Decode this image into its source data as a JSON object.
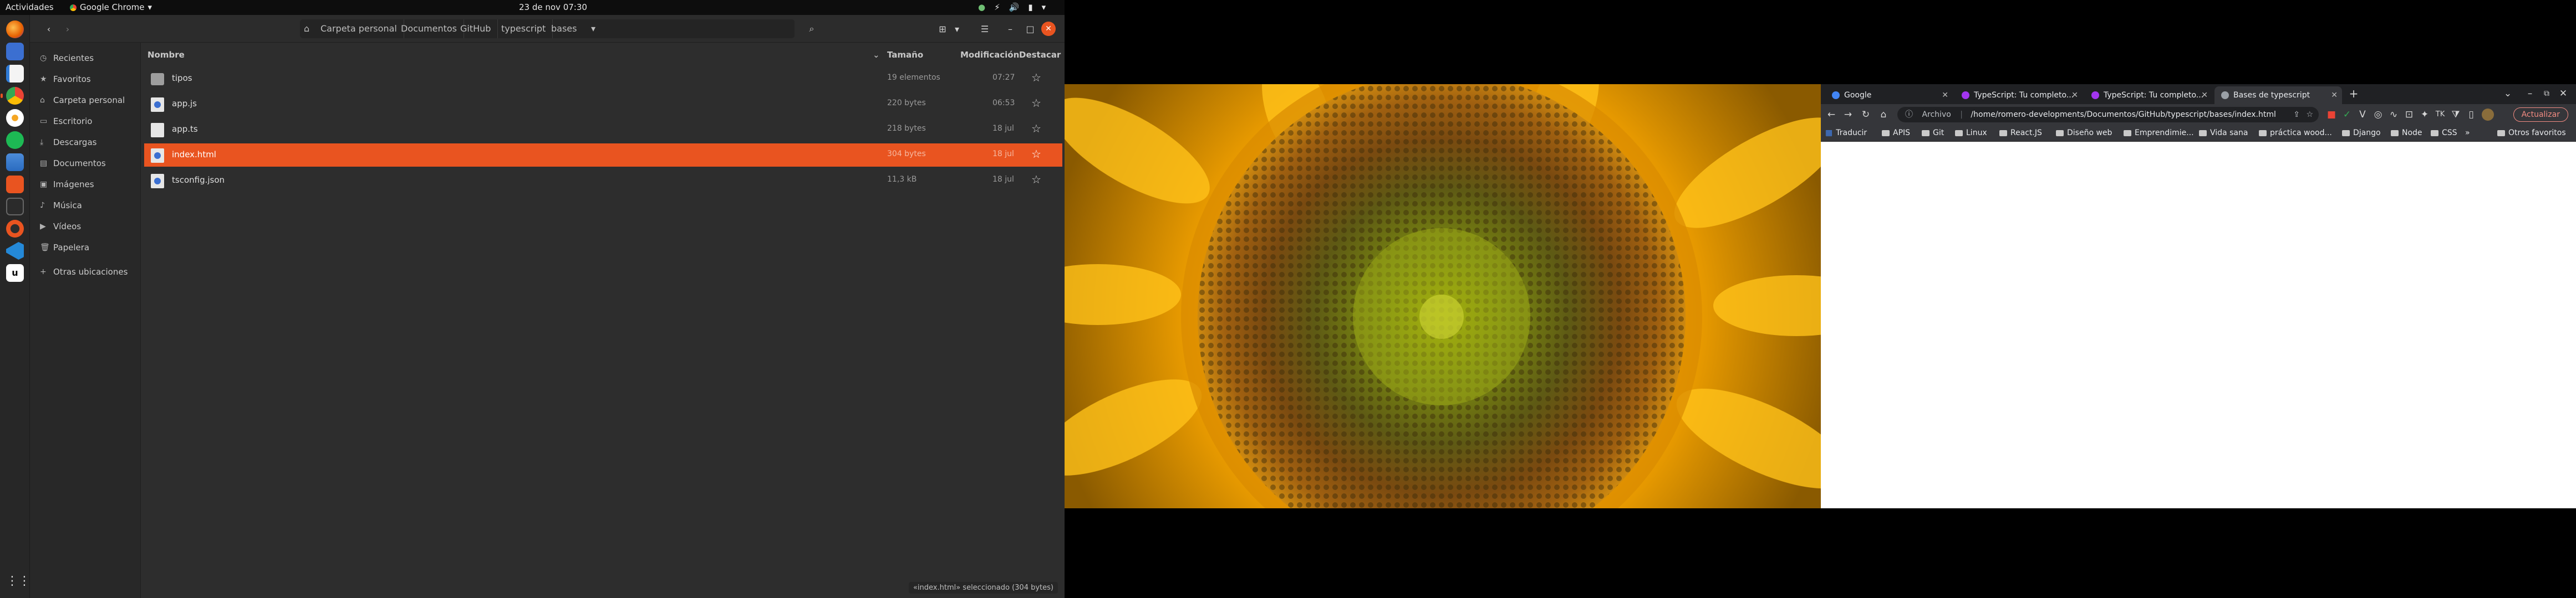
{
  "topbar": {
    "activities": "Actividades",
    "app_name": "Google Chrome",
    "clock": "23 de nov  07:30"
  },
  "dock": {
    "items": [
      {
        "name": "firefox-icon",
        "color": "#e66000"
      },
      {
        "name": "calendar-icon",
        "color": "#3b6fd1"
      },
      {
        "name": "text-editor-icon",
        "color": "#2f7bd6"
      },
      {
        "name": "chrome-icon",
        "color": "#4caf50"
      },
      {
        "name": "rhythmbox-icon",
        "color": "#e8e8e8"
      },
      {
        "name": "spotify-icon",
        "color": "#1db954"
      },
      {
        "name": "libreoffice-icon",
        "color": "#4c8cd9"
      },
      {
        "name": "software-icon",
        "color": "#e95420"
      },
      {
        "name": "terminal-icon",
        "color": "#333333"
      },
      {
        "name": "help-icon",
        "color": "#e95420"
      },
      {
        "name": "vscode-icon",
        "color": "#2489d8"
      },
      {
        "name": "app-icon",
        "color": "#ffffff"
      }
    ]
  },
  "files": {
    "breadcrumbs": [
      "Carpeta personal",
      "Documentos",
      "GitHub",
      "typescript",
      "bases"
    ],
    "sidebar": [
      {
        "label": "Recientes",
        "icon": "clock-icon"
      },
      {
        "label": "Favoritos",
        "icon": "star-icon"
      },
      {
        "label": "Carpeta personal",
        "icon": "home-icon"
      },
      {
        "label": "Escritorio",
        "icon": "desktop-icon"
      },
      {
        "label": "Descargas",
        "icon": "download-icon"
      },
      {
        "label": "Documentos",
        "icon": "document-icon"
      },
      {
        "label": "Imágenes",
        "icon": "image-icon"
      },
      {
        "label": "Música",
        "icon": "music-icon"
      },
      {
        "label": "Vídeos",
        "icon": "video-icon"
      },
      {
        "label": "Papelera",
        "icon": "trash-icon"
      },
      {
        "label": "Otras ubicaciones",
        "icon": "plus-icon"
      }
    ],
    "columns": {
      "name": "Nombre",
      "size": "Tamaño",
      "modified": "Modificación",
      "starred": "Destacar"
    },
    "rows": [
      {
        "name": "tipos",
        "size": "19 elementos",
        "modified": "07:27",
        "type": "folder",
        "selected": false
      },
      {
        "name": "app.js",
        "size": "220 bytes",
        "modified": "06:53",
        "type": "js",
        "selected": false
      },
      {
        "name": "app.ts",
        "size": "218 bytes",
        "modified": "18 jul",
        "type": "ts",
        "selected": false
      },
      {
        "name": "index.html",
        "size": "304 bytes",
        "modified": "18 jul",
        "type": "html",
        "selected": true
      },
      {
        "name": "tsconfig.json",
        "size": "11,3 kB",
        "modified": "18 jul",
        "type": "json",
        "selected": false
      }
    ],
    "status": "«index.html» seleccionado (304 bytes)"
  },
  "chrome": {
    "tabs": [
      {
        "title": "Google",
        "active": false,
        "favicon": "#4285f4"
      },
      {
        "title": "TypeScript: Tu completo...",
        "active": false,
        "favicon": "#a435f0"
      },
      {
        "title": "TypeScript: Tu completo...",
        "active": false,
        "favicon": "#a435f0"
      },
      {
        "title": "Bases de typescript",
        "active": true,
        "favicon": "#9aa0a6"
      }
    ],
    "omnibox_scheme": "Archivo",
    "omnibox_url": "/home/romero-developments/Documentos/GitHub/typescript/bases/index.html",
    "update_label": "Actualizar",
    "bookmarks": [
      "Traducir",
      "APIS",
      "Git",
      "Linux",
      "React.JS",
      "Diseño web",
      "Emprendimie...",
      "Vida sana",
      "práctica wood...",
      "Django",
      "Node",
      "CSS"
    ],
    "other_bookmarks": "Otros favoritos"
  }
}
